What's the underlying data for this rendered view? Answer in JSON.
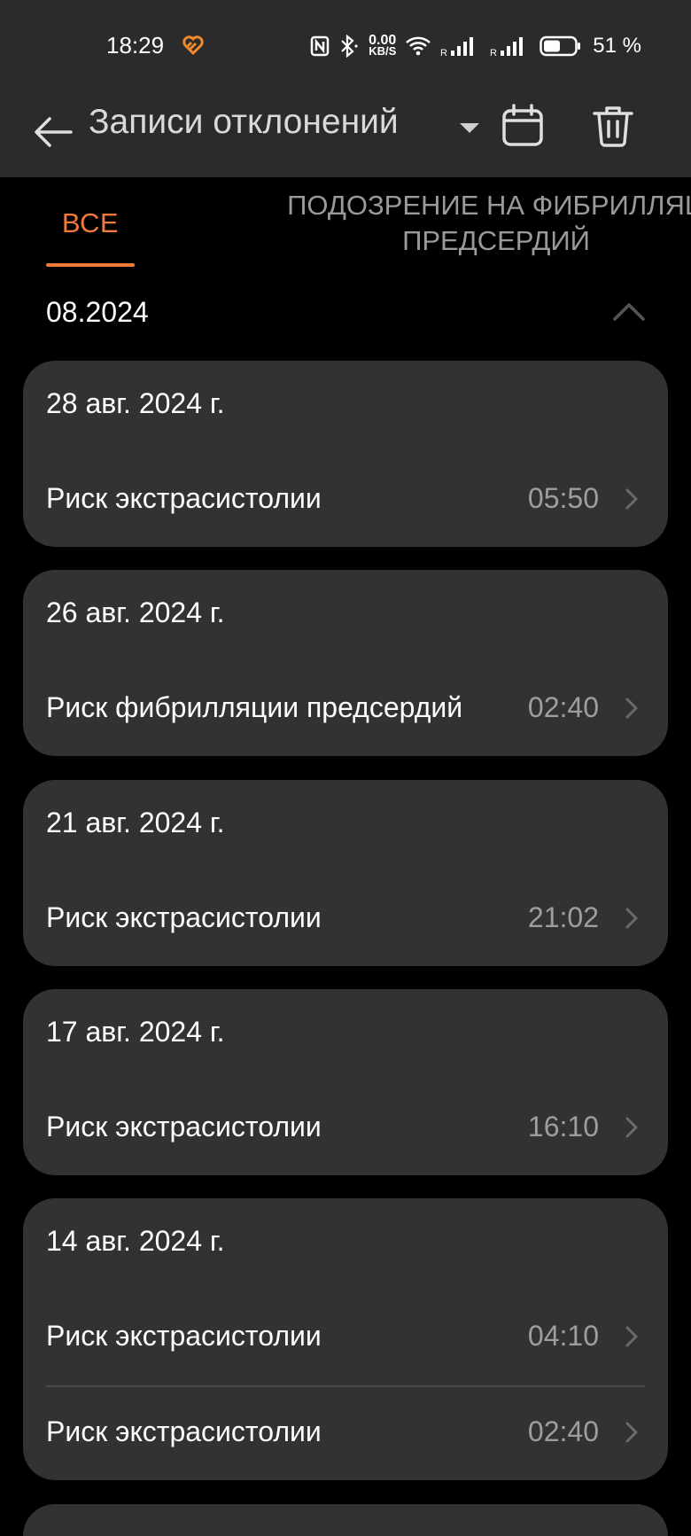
{
  "status_bar": {
    "time": "18:29",
    "speed_value": "0.00",
    "speed_unit": "KB/S",
    "roaming_1": "R",
    "roaming_2": "R",
    "battery_percent": "51 %"
  },
  "app_bar": {
    "title": "Записи отклонений",
    "icons": [
      "back-arrow-icon",
      "dropdown-icon",
      "calendar-icon",
      "trash-icon"
    ]
  },
  "tabs": [
    {
      "label": "ВСЕ",
      "active": true
    },
    {
      "label": "ПОДОЗРЕНИЕ НА ФИБРИЛЛЯЦ\nПРЕДСЕРДИЙ",
      "active": false
    }
  ],
  "month_group": {
    "label": "08.2024",
    "expanded": true
  },
  "cards": [
    {
      "date": "28 авг. 2024 г.",
      "entries": [
        {
          "label": "Риск экстрасистолии",
          "time": "05:50"
        }
      ]
    },
    {
      "date": "26 авг. 2024 г.",
      "entries": [
        {
          "label": "Риск фибрилляции предсердий",
          "time": "02:40"
        }
      ]
    },
    {
      "date": "21 авг. 2024 г.",
      "entries": [
        {
          "label": "Риск экстрасистолии",
          "time": "21:02"
        }
      ]
    },
    {
      "date": "17 авг. 2024 г.",
      "entries": [
        {
          "label": "Риск экстрасистолии",
          "time": "16:10"
        }
      ]
    },
    {
      "date": "14 авг. 2024 г.",
      "entries": [
        {
          "label": "Риск экстрасистолии",
          "time": "04:10"
        },
        {
          "label": "Риск экстрасистолии",
          "time": "02:40"
        }
      ]
    }
  ],
  "colors": {
    "accent": "#f07a3a",
    "card": "#323232",
    "background": "#000000",
    "bar": "#2b2b2b"
  }
}
